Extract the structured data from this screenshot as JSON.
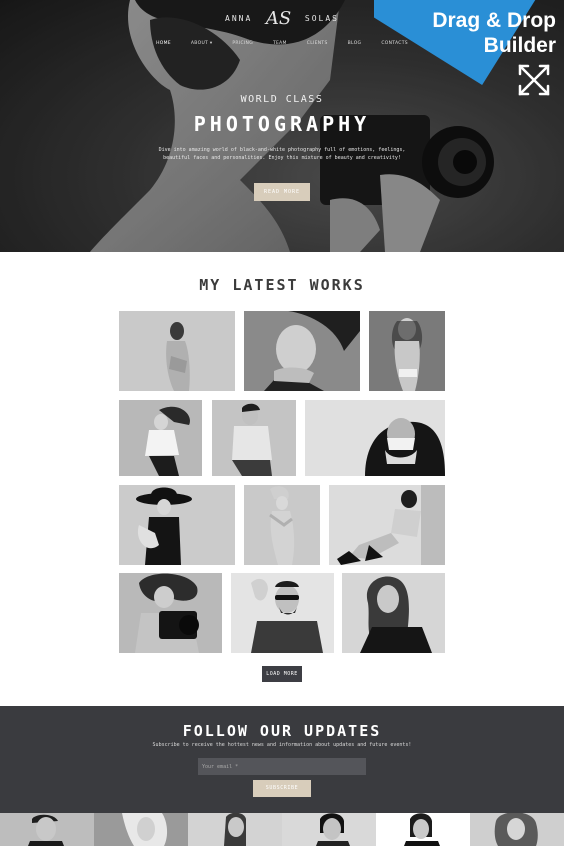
{
  "brand": {
    "left": "ANNA",
    "monogram": "AS",
    "right": "SOLAS"
  },
  "nav": [
    {
      "label": "HOME"
    },
    {
      "label": "ABOUT ▾"
    },
    {
      "label": "PRICING"
    },
    {
      "label": "TEAM"
    },
    {
      "label": "CLIENTS"
    },
    {
      "label": "BLOG"
    },
    {
      "label": "CONTACTS"
    }
  ],
  "badge": {
    "line1": "Drag & Drop",
    "line2": "Builder"
  },
  "hero": {
    "subtitle": "WORLD CLASS",
    "title": "PHOTOGRAPHY",
    "text": "Dive into amazing world of black-and-white photography full of emotions, feelings, beautiful faces and personalities. Enjoy this mixture of beauty and creativity!",
    "button": "READ MORE"
  },
  "works": {
    "title": "MY LATEST WORKS",
    "load_more": "LOAD MORE"
  },
  "follow": {
    "title": "FOLLOW OUR UPDATES",
    "text": "Subscribe to receive the hottest news and information about updates and future events!",
    "email_placeholder": "Your email *",
    "button": "SUBSCRIBE"
  },
  "colors": {
    "accent_beige": "#d8cdbb",
    "dark_panel": "#3a3b3f",
    "badge_blue": "#2a8fd6"
  }
}
